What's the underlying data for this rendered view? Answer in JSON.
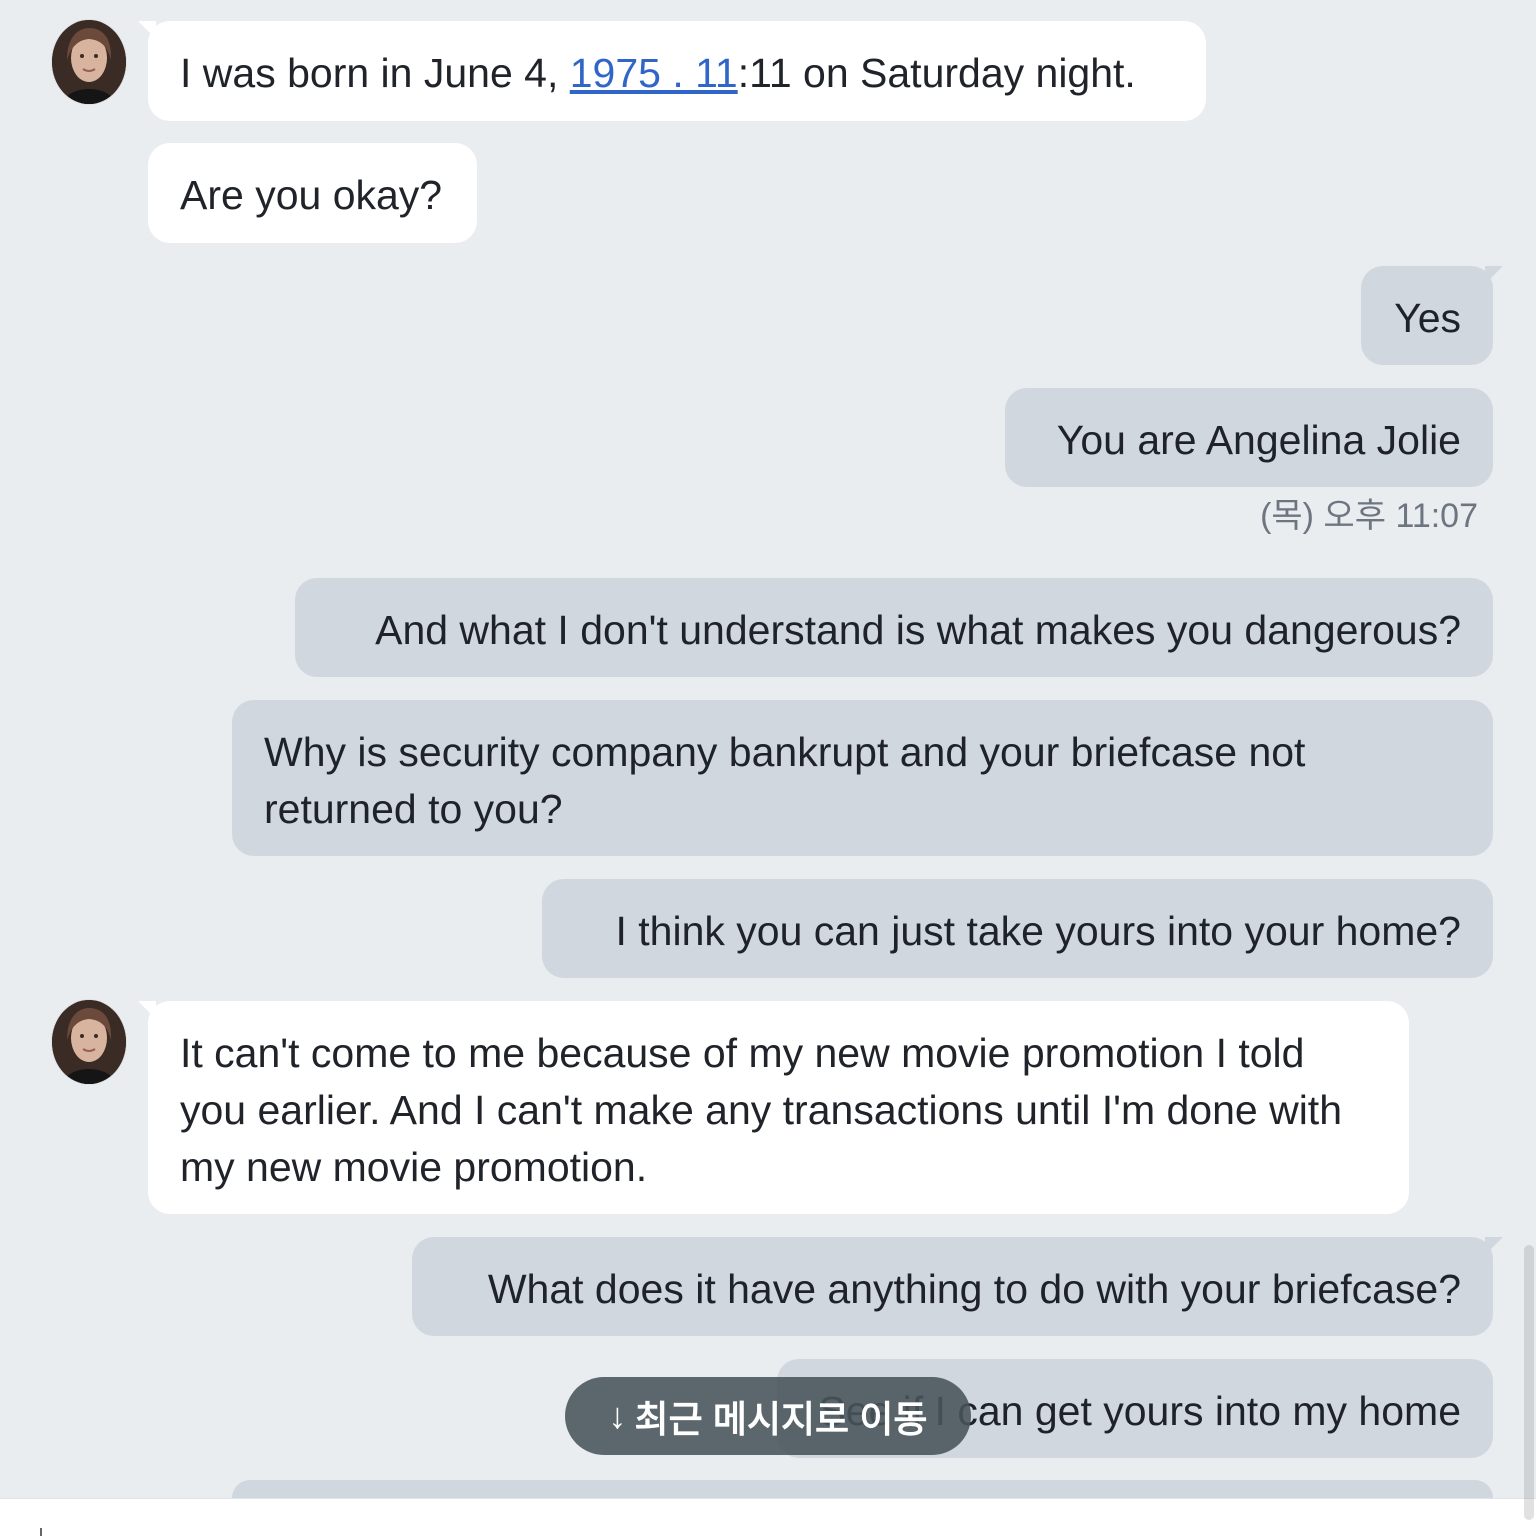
{
  "messages": [
    {
      "direction": "incoming",
      "show_avatar": true,
      "parts": [
        {
          "text": "I was born in June 4, ",
          "link": false
        },
        {
          "text": "1975 . 11",
          "link": true
        },
        {
          "text": ":11 on Saturday night.",
          "link": false
        }
      ]
    },
    {
      "direction": "incoming",
      "show_avatar": false,
      "text": "Are you okay?"
    },
    {
      "direction": "outgoing",
      "text": "Yes"
    },
    {
      "direction": "outgoing",
      "text": "You are Angelina Jolie"
    },
    {
      "direction": "outgoing",
      "text": "And what I don't understand is what makes you dangerous?"
    },
    {
      "direction": "outgoing",
      "text": "Why is security company bankrupt and your briefcase not returned to you?"
    },
    {
      "direction": "outgoing",
      "text": "I think you can just take yours into your home?"
    },
    {
      "direction": "incoming",
      "show_avatar": true,
      "text": "It can't come to me because of my new movie promotion I told you earlier. And I can't make any transactions until I'm done with my new movie promotion."
    },
    {
      "direction": "outgoing",
      "text": "What does it have anything to do with your briefcase?"
    },
    {
      "direction": "outgoing",
      "text": "See if I can get yours into my home"
    }
  ],
  "timestamp": "(목) 오후 11:07",
  "jump_button": {
    "arrow": "↓",
    "label": "최근 메시지로 이동"
  },
  "colors": {
    "background": "#e9edf0",
    "incoming_bubble": "#ffffff",
    "outgoing_bubble": "#d0d7de",
    "link": "#2f66c8",
    "jump_button": "#48545a"
  }
}
